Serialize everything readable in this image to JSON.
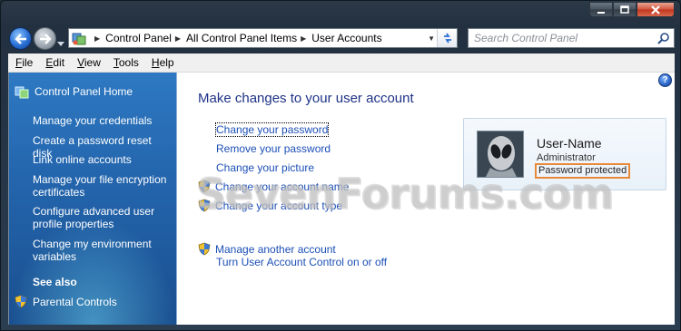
{
  "address_bar": {
    "crumbs": [
      "Control Panel",
      "All Control Panel Items",
      "User Accounts"
    ],
    "search_placeholder": "Search Control Panel"
  },
  "menubar": {
    "items": [
      {
        "first": "F",
        "rest": "ile"
      },
      {
        "first": "E",
        "rest": "dit"
      },
      {
        "first": "V",
        "rest": "iew"
      },
      {
        "first": "T",
        "rest": "ools"
      },
      {
        "first": "H",
        "rest": "elp"
      }
    ]
  },
  "sidebar": {
    "home_label": "Control Panel Home",
    "tasks": [
      "Manage your credentials",
      "Create a password reset disk",
      "Link online accounts",
      "Manage your file encryption certificates",
      "Configure advanced user profile properties",
      "Change my environment variables"
    ],
    "see_also_label": "See also",
    "parental_controls_label": "Parental Controls"
  },
  "main": {
    "title": "Make changes to your user account",
    "actions": [
      "Change your password",
      "Remove your password",
      "Change your picture",
      "Change your account name",
      "Change your account type"
    ],
    "other_actions": [
      "Manage another account",
      "Turn User Account Control on or off"
    ]
  },
  "user_card": {
    "name": "User-Name",
    "role": "Administrator",
    "password_status": "Password protected"
  },
  "watermark": "SevenForums.com",
  "colors": {
    "link": "#1c4fb6",
    "title": "#1e3287",
    "sidebar_top": "#2e79c2",
    "highlight_box": "#e8893a"
  },
  "icons": {
    "back": "back-arrow-icon",
    "forward": "forward-arrow-icon",
    "refresh": "refresh-icon",
    "search": "search-icon",
    "uac": "uac-shield-icon",
    "help": "help-icon"
  }
}
